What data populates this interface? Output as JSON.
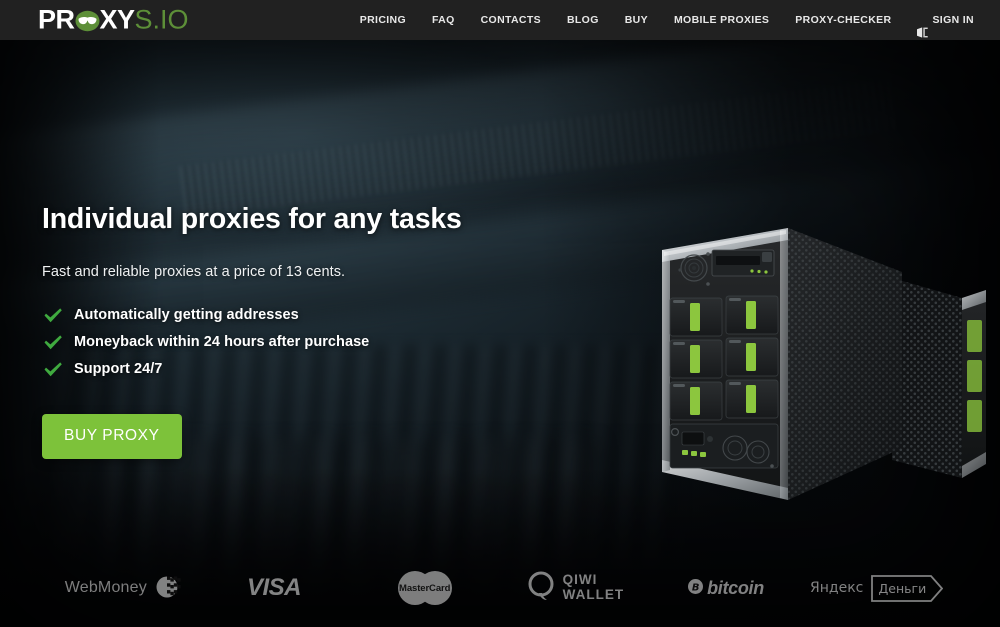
{
  "header": {
    "logo": {
      "part1": "PR",
      "icon": "proxy-mask-icon",
      "part2": "XY",
      "part3": "S.IO"
    },
    "nav": [
      {
        "label": "PRICING",
        "name": "nav-pricing"
      },
      {
        "label": "FAQ",
        "name": "nav-faq"
      },
      {
        "label": "CONTACTS",
        "name": "nav-contacts"
      },
      {
        "label": "BLOG",
        "name": "nav-blog"
      },
      {
        "label": "BUY",
        "name": "nav-buy"
      },
      {
        "label": "MOBILE PROXIES",
        "name": "nav-mobile-proxies"
      },
      {
        "label": "PROXY-CHECKER",
        "name": "nav-proxy-checker"
      }
    ],
    "signin": {
      "label": "SIGN IN",
      "icon": "login-icon"
    },
    "background_color": "#212121"
  },
  "hero": {
    "headline": "Individual proxies for any tasks",
    "subline": "Fast and reliable proxies at a price of 13 cents.",
    "features": [
      {
        "label": "Automatically getting addresses",
        "icon": "check-icon"
      },
      {
        "label": "Moneyback within 24 hours after purchase",
        "icon": "check-icon"
      },
      {
        "label": "Support 24/7",
        "icon": "check-icon"
      }
    ],
    "cta": {
      "label": "BUY PROXY",
      "color": "#7dc23a"
    },
    "artwork": "server-tower-image"
  },
  "payments": [
    {
      "name": "payment-webmoney",
      "label": "WebMoney",
      "icon": "webmoney-icon"
    },
    {
      "name": "payment-visa",
      "label": "VISA",
      "icon": "visa-icon"
    },
    {
      "name": "payment-mastercard",
      "label": "MasterCard",
      "icon": "mastercard-icon"
    },
    {
      "name": "payment-qiwi",
      "label_top": "QIWI",
      "label_bottom": "WALLET",
      "icon": "qiwi-icon"
    },
    {
      "name": "payment-bitcoin",
      "label": "bitcoin",
      "icon": "bitcoin-icon"
    },
    {
      "name": "payment-yandex",
      "label": "Яндекс",
      "badge": "Деньги",
      "icon": "yandex-money-icon"
    }
  ],
  "colors": {
    "accent_green": "#7dc23a",
    "logo_green": "#5d8f38",
    "check_green": "#3faa3f",
    "header_bg": "#212121"
  }
}
